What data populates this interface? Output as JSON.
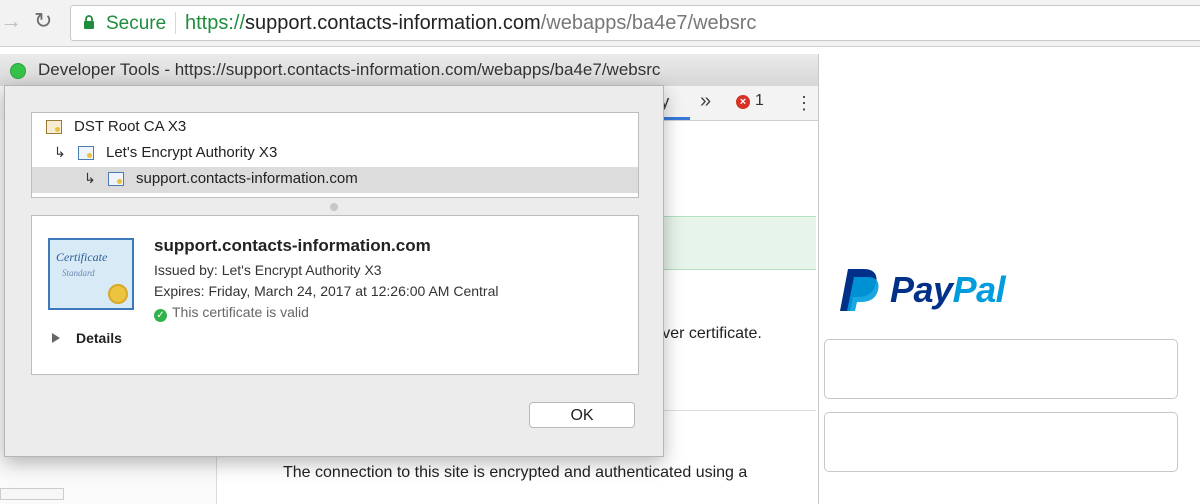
{
  "browser": {
    "secure_label": "Secure",
    "url": {
      "scheme": "https://",
      "host": "support.contacts-information.com",
      "path": "/webapps/ba4e7/websrc"
    }
  },
  "devtools": {
    "title": "Developer Tools - https://support.contacts-information.com/webapps/ba4e7/websrc",
    "active_tab_partial": "ty",
    "overflow_glyph": "»",
    "error_count": "1",
    "server_text_fragment": "erver certificate.",
    "connection_text": "The connection to this site is encrypted and authenticated using a"
  },
  "certificate_dialog": {
    "chain": [
      {
        "label": "DST Root CA X3"
      },
      {
        "label": "Let's Encrypt Authority X3"
      },
      {
        "label": "support.contacts-information.com"
      }
    ],
    "badge": {
      "title": "Certificate",
      "subtitle": "Standard"
    },
    "subject": "support.contacts-information.com",
    "issued_by": "Issued by: Let's Encrypt Authority X3",
    "expires": "Expires: Friday, March 24, 2017 at 12:26:00 AM Central",
    "valid_text": "This certificate is valid",
    "details_label": "Details",
    "ok_label": "OK"
  },
  "page": {
    "brand_pay": "Pay",
    "brand_pal": "Pal"
  },
  "colors": {
    "secure_green": "#1e8e3e",
    "paypal_dark": "#003087",
    "paypal_light": "#009cde",
    "error_red": "#d93025",
    "valid_green": "#2fb34a"
  }
}
